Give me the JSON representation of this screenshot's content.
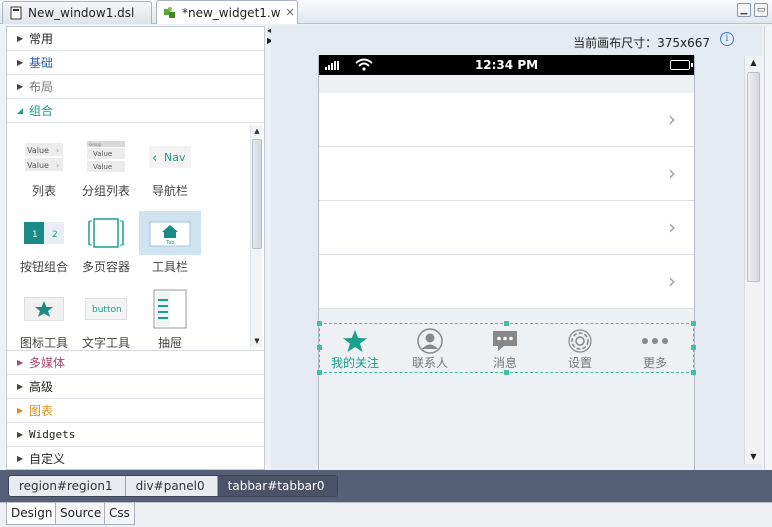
{
  "tabs": [
    {
      "label": "New_window1.dsl"
    },
    {
      "label": "*new_widget1.w",
      "close": "✕"
    }
  ],
  "palette": {
    "categories_top": [
      {
        "label": "常用",
        "style": "normal"
      },
      {
        "label": "基础",
        "style": "blue"
      },
      {
        "label": "布局",
        "style": "gray"
      },
      {
        "label": "组合",
        "style": "teal"
      }
    ],
    "components": [
      {
        "label": "列表",
        "icon": "list-icon"
      },
      {
        "label": "分组列表",
        "icon": "grouped-list-icon"
      },
      {
        "label": "导航栏",
        "icon": "navbar-icon"
      },
      {
        "label": "按钮组合",
        "icon": "button-group-icon"
      },
      {
        "label": "多页容器",
        "icon": "multipage-icon"
      },
      {
        "label": "工具栏",
        "icon": "toolbar-icon"
      },
      {
        "label": "图标工具",
        "icon": "icon-tool-icon"
      },
      {
        "label": "文字工具",
        "icon": "text-tool-icon"
      },
      {
        "label": "抽屉",
        "icon": "drawer-icon"
      }
    ],
    "thumb_text": {
      "value": "Value",
      "group": "Group",
      "nav": "Nav",
      "btn1": "1",
      "btn2": "2",
      "tab": "Tab",
      "button": "button"
    },
    "categories_bottom": [
      {
        "label": "多媒体",
        "style": "pink"
      },
      {
        "label": "高级",
        "style": "normal"
      },
      {
        "label": "图表",
        "style": "orange"
      },
      {
        "label": "Widgets",
        "style": "mono"
      },
      {
        "label": "自定义",
        "style": "normal"
      }
    ]
  },
  "canvas": {
    "size_label": "当前画布尺寸：375x667",
    "info": "i"
  },
  "phone": {
    "time": "12:34 PM",
    "rows": 4,
    "chevron": "›",
    "tabbar": [
      {
        "label": "我的关注",
        "icon": "star-icon",
        "active": true
      },
      {
        "label": "联系人",
        "icon": "contact-icon",
        "active": false
      },
      {
        "label": "消息",
        "icon": "message-icon",
        "active": false
      },
      {
        "label": "设置",
        "icon": "settings-icon",
        "active": false
      },
      {
        "label": "更多",
        "icon": "more-icon",
        "active": false
      }
    ]
  },
  "breadcrumb": [
    "region#region1",
    "div#panel0",
    "tabbar#tabbar0"
  ],
  "bottom_tabs": [
    "Design",
    "Source",
    "Css"
  ],
  "colors": {
    "accent": "#1aa08b",
    "dark_bar": "#556078"
  }
}
